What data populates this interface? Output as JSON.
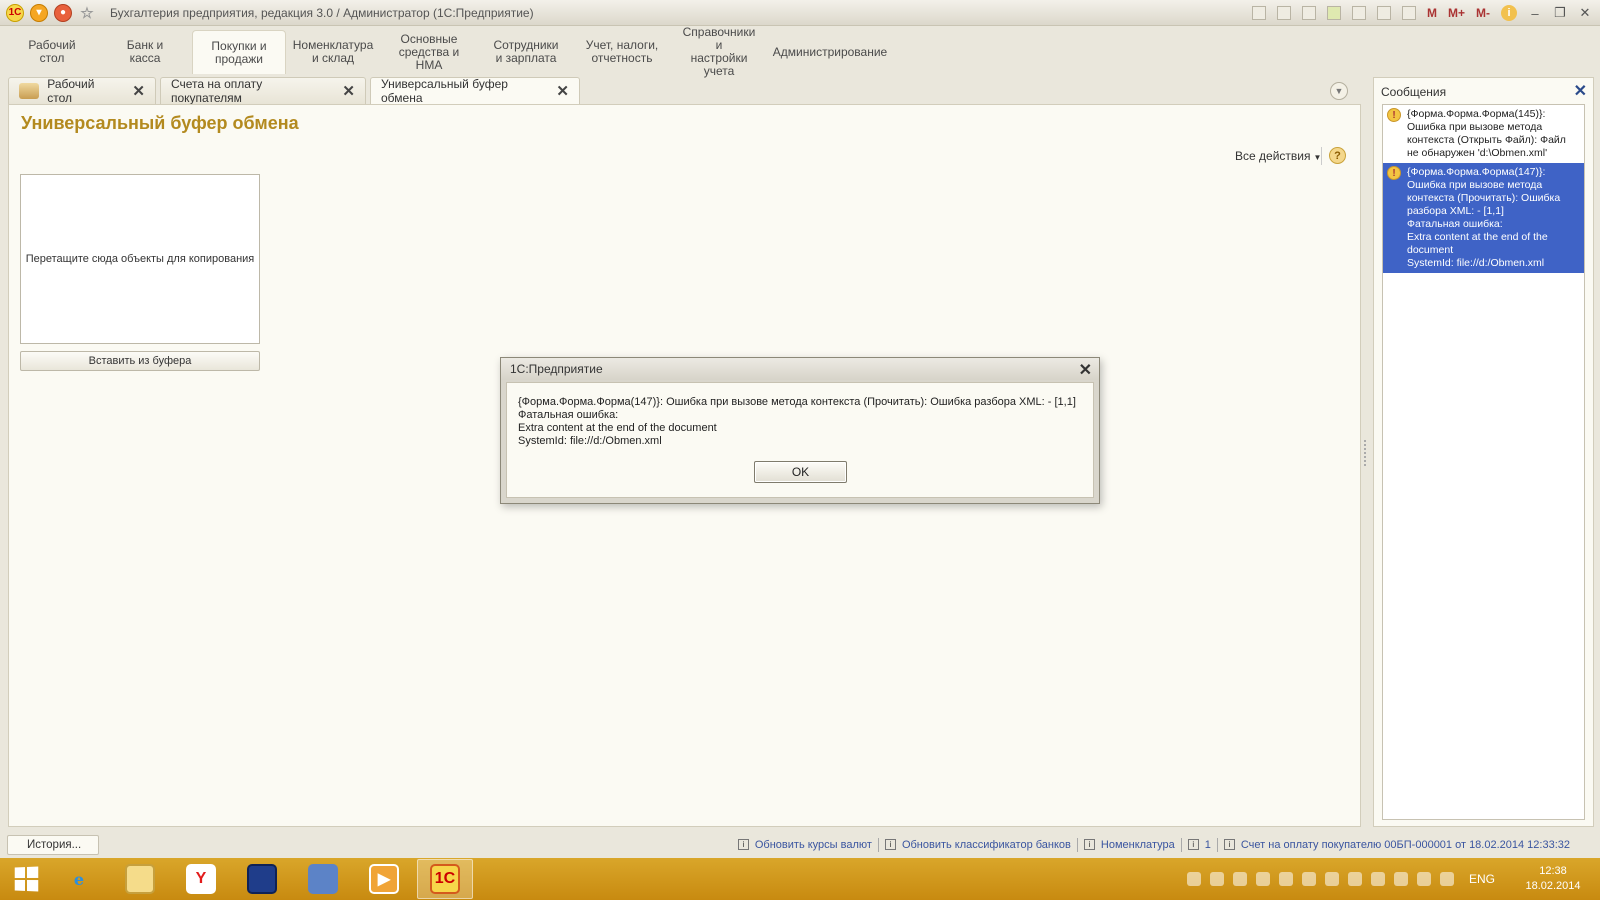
{
  "window": {
    "title": "Бухгалтерия предприятия, редакция 3.0 / Администратор  (1С:Предприятие)",
    "logo_text": "1С",
    "right_labels": {
      "m": "M",
      "mplus": "M+",
      "mminus": "M-"
    }
  },
  "sections": [
    {
      "label": "Рабочий\nстол",
      "active": false
    },
    {
      "label": "Банк и\nкасса",
      "active": false
    },
    {
      "label": "Покупки и\nпродажи",
      "active": true
    },
    {
      "label": "Номенклатура\nи склад",
      "active": false
    },
    {
      "label": "Основные\nсредства и НМА",
      "active": false
    },
    {
      "label": "Сотрудники\nи зарплата",
      "active": false
    },
    {
      "label": "Учет, налоги,\nотчетность",
      "active": false
    },
    {
      "label": "Справочники и\nнастройки учета",
      "active": false
    },
    {
      "label": "Администрирование",
      "active": false
    }
  ],
  "tabs": [
    {
      "label": "Рабочий стол"
    },
    {
      "label": "Счета на оплату покупателям"
    },
    {
      "label": "Универсальный буфер обмена"
    }
  ],
  "main": {
    "title": "Универсальный буфер обмена",
    "all_actions": "Все действия",
    "help": "?",
    "dropzone_text": "Перетащите сюда объекты для копирования",
    "paste_button": "Вставить из буфера"
  },
  "messages": {
    "title": "Сообщения",
    "items": [
      {
        "lines": [
          "{Форма.Форма.Форма(145)}:",
          "Ошибка при вызове метода",
          "контекста (Открыть Файл): Файл",
          "не обнаружен 'd:\\Obmen.xml'"
        ]
      },
      {
        "lines": [
          "{Форма.Форма.Форма(147)}:",
          "Ошибка при вызове метода",
          "контекста (Прочитать): Ошибка",
          "разбора XML:  - [1,1]",
          "Фатальная ошибка:",
          "Extra content at the end of the",
          "document",
          "SystemId: file://d:/Obmen.xml"
        ]
      }
    ]
  },
  "dialog": {
    "title": "1С:Предприятие",
    "lines": [
      "{Форма.Форма.Форма(147)}: Ошибка при вызове метода контекста (Прочитать): Ошибка разбора XML:  - [1,1]",
      "Фатальная ошибка:",
      "Extra content at the end of the document",
      "SystemId: file://d:/Obmen.xml"
    ],
    "ok_label": "OK"
  },
  "statusbar": {
    "history_label": "История...",
    "notifications": [
      "Обновить курсы валют",
      "Обновить классификатор банков",
      "Номенклатура",
      "1",
      "Счет на оплату покупателю 00БП-000001 от 18.02.2014 12:33:32"
    ]
  },
  "taskbar": {
    "apps": [
      "ie-icon",
      "file-explorer-icon",
      "yandex-browser-icon",
      "save-disk-icon",
      "network-app-icon",
      "media-player-icon",
      "1c-app-icon"
    ],
    "language": "ENG",
    "time": "12:38",
    "date": "18.02.2014"
  }
}
